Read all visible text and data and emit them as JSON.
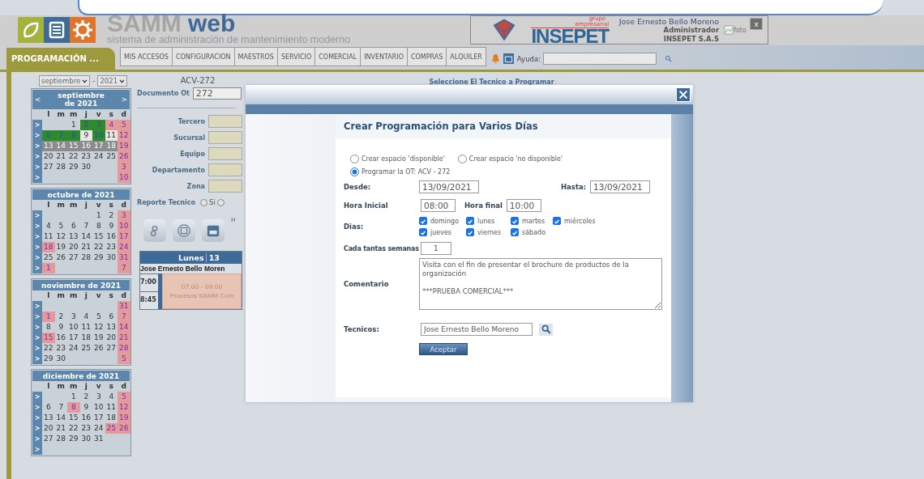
{
  "header": {
    "title_main": "SAMM",
    "title_accent": "web",
    "subtitle": "sistema de administración de mantenimiento moderno",
    "company": {
      "tagline_1": "grupo",
      "tagline_2": "empresarial",
      "name": "INSEPET"
    },
    "user": {
      "name": "Jose Ernesto Bello Moreno",
      "role": "Administrador",
      "company": "INSEPET S.A.S",
      "photo_alt": "foto",
      "close": "x"
    }
  },
  "nav": {
    "tabs": [
      {
        "label": "PROGRAMACIÓN ...",
        "selected": true
      }
    ],
    "menu": [
      "MIS ACCESOS",
      "CONFIGURACION",
      "MAESTROS",
      "SERVICIO",
      "COMERCIAL",
      "INVENTARIO",
      "COMPRAS",
      "ALQUILER"
    ],
    "help_label": "Ayuda:"
  },
  "calendar": {
    "month_select": "septiembre",
    "separator": "-",
    "year_select": "2021",
    "months": [
      {
        "title": "septiembre de 2021",
        "prev": "<",
        "next": ">",
        "weekdays": [
          "l",
          "m",
          "m",
          "j",
          "v",
          "s",
          "d"
        ],
        "weeks": [
          {
            "marker": ">",
            "days": [
              {
                "kind": "blank"
              },
              {
                "kind": "blank"
              },
              {
                "day": "1",
                "kind": "normal"
              },
              {
                "day": "2",
                "kind": "busy"
              },
              {
                "day": "3",
                "kind": "busy"
              },
              {
                "day": "4",
                "kind": "holiday"
              },
              {
                "day": "5",
                "kind": "holiday"
              }
            ]
          },
          {
            "marker": ">",
            "days": [
              {
                "day": "6",
                "kind": "busy"
              },
              {
                "day": "7",
                "kind": "busy"
              },
              {
                "day": "8",
                "kind": "busy"
              },
              {
                "day": "9",
                "kind": "light"
              },
              {
                "day": "10",
                "kind": "busy"
              },
              {
                "day": "11",
                "kind": "light"
              },
              {
                "day": "12",
                "kind": "holiday"
              }
            ]
          },
          {
            "marker": ">",
            "days": [
              {
                "day": "13",
                "kind": "shaded"
              },
              {
                "day": "14",
                "kind": "shaded"
              },
              {
                "day": "15",
                "kind": "shaded"
              },
              {
                "day": "16",
                "kind": "shaded"
              },
              {
                "day": "17",
                "kind": "shaded"
              },
              {
                "day": "18",
                "kind": "shaded"
              },
              {
                "day": "19",
                "kind": "holiday"
              }
            ]
          },
          {
            "marker": ">",
            "days": [
              {
                "day": "20",
                "kind": "normal"
              },
              {
                "day": "21",
                "kind": "normal"
              },
              {
                "day": "22",
                "kind": "normal"
              },
              {
                "day": "23",
                "kind": "normal"
              },
              {
                "day": "24",
                "kind": "normal"
              },
              {
                "day": "25",
                "kind": "normal"
              },
              {
                "day": "26",
                "kind": "holiday"
              }
            ]
          },
          {
            "marker": ">",
            "days": [
              {
                "day": "27",
                "kind": "normal"
              },
              {
                "day": "28",
                "kind": "normal"
              },
              {
                "day": "29",
                "kind": "normal"
              },
              {
                "day": "30",
                "kind": "normal"
              },
              {
                "kind": "blank"
              },
              {
                "kind": "blank"
              },
              {
                "day": "3",
                "kind": "holiday"
              }
            ]
          },
          {
            "marker": ">",
            "days": [
              {
                "kind": "blank"
              },
              {
                "kind": "blank"
              },
              {
                "kind": "blank"
              },
              {
                "kind": "blank"
              },
              {
                "kind": "blank"
              },
              {
                "kind": "blank"
              },
              {
                "day": "10",
                "kind": "holiday"
              }
            ]
          }
        ]
      },
      {
        "title": "octubre de 2021",
        "weekdays": [
          "l",
          "m",
          "m",
          "j",
          "v",
          "s",
          "d"
        ],
        "weeks": [
          {
            "marker": ">",
            "days": [
              {
                "kind": "blank"
              },
              {
                "kind": "blank"
              },
              {
                "kind": "blank"
              },
              {
                "kind": "blank"
              },
              {
                "day": "1",
                "kind": "normal"
              },
              {
                "day": "2",
                "kind": "normal"
              },
              {
                "day": "3",
                "kind": "holiday"
              }
            ]
          },
          {
            "marker": ">",
            "days": [
              {
                "day": "4",
                "kind": "normal"
              },
              {
                "day": "5",
                "kind": "normal"
              },
              {
                "day": "6",
                "kind": "normal"
              },
              {
                "day": "7",
                "kind": "normal"
              },
              {
                "day": "8",
                "kind": "normal"
              },
              {
                "day": "9",
                "kind": "normal"
              },
              {
                "day": "10",
                "kind": "holiday"
              }
            ]
          },
          {
            "marker": ">",
            "days": [
              {
                "day": "11",
                "kind": "normal"
              },
              {
                "day": "12",
                "kind": "normal"
              },
              {
                "day": "13",
                "kind": "normal"
              },
              {
                "day": "14",
                "kind": "normal"
              },
              {
                "day": "15",
                "kind": "normal"
              },
              {
                "day": "16",
                "kind": "normal"
              },
              {
                "day": "17",
                "kind": "holiday"
              }
            ]
          },
          {
            "marker": ">",
            "days": [
              {
                "day": "18",
                "kind": "holiday"
              },
              {
                "day": "19",
                "kind": "normal"
              },
              {
                "day": "20",
                "kind": "normal"
              },
              {
                "day": "21",
                "kind": "normal"
              },
              {
                "day": "22",
                "kind": "normal"
              },
              {
                "day": "23",
                "kind": "normal"
              },
              {
                "day": "24",
                "kind": "holiday"
              }
            ]
          },
          {
            "marker": ">",
            "days": [
              {
                "day": "25",
                "kind": "normal"
              },
              {
                "day": "26",
                "kind": "normal"
              },
              {
                "day": "27",
                "kind": "normal"
              },
              {
                "day": "28",
                "kind": "normal"
              },
              {
                "day": "29",
                "kind": "normal"
              },
              {
                "day": "30",
                "kind": "normal"
              },
              {
                "day": "31",
                "kind": "holiday"
              }
            ]
          },
          {
            "marker": ">",
            "days": [
              {
                "day": "1",
                "kind": "holiday"
              },
              {
                "kind": "blank"
              },
              {
                "kind": "blank"
              },
              {
                "kind": "blank"
              },
              {
                "kind": "blank"
              },
              {
                "kind": "blank"
              },
              {
                "day": "7",
                "kind": "holiday"
              }
            ]
          }
        ]
      },
      {
        "title": "noviembre de 2021",
        "weekdays": [
          "l",
          "m",
          "m",
          "j",
          "v",
          "s",
          "d"
        ],
        "weeks": [
          {
            "marker": ">",
            "days": [
              {
                "kind": "blank"
              },
              {
                "kind": "blank"
              },
              {
                "kind": "blank"
              },
              {
                "kind": "blank"
              },
              {
                "kind": "blank"
              },
              {
                "kind": "blank"
              },
              {
                "day": "31",
                "kind": "holiday"
              }
            ]
          },
          {
            "marker": ">",
            "days": [
              {
                "day": "1",
                "kind": "holiday"
              },
              {
                "day": "2",
                "kind": "normal"
              },
              {
                "day": "3",
                "kind": "normal"
              },
              {
                "day": "4",
                "kind": "normal"
              },
              {
                "day": "5",
                "kind": "normal"
              },
              {
                "day": "6",
                "kind": "normal"
              },
              {
                "day": "7",
                "kind": "holiday"
              }
            ]
          },
          {
            "marker": ">",
            "days": [
              {
                "day": "8",
                "kind": "normal"
              },
              {
                "day": "9",
                "kind": "normal"
              },
              {
                "day": "10",
                "kind": "normal"
              },
              {
                "day": "11",
                "kind": "normal"
              },
              {
                "day": "12",
                "kind": "normal"
              },
              {
                "day": "13",
                "kind": "normal"
              },
              {
                "day": "14",
                "kind": "holiday"
              }
            ]
          },
          {
            "marker": ">",
            "days": [
              {
                "day": "15",
                "kind": "holiday"
              },
              {
                "day": "16",
                "kind": "normal"
              },
              {
                "day": "17",
                "kind": "normal"
              },
              {
                "day": "18",
                "kind": "normal"
              },
              {
                "day": "19",
                "kind": "normal"
              },
              {
                "day": "20",
                "kind": "normal"
              },
              {
                "day": "21",
                "kind": "holiday"
              }
            ]
          },
          {
            "marker": ">",
            "days": [
              {
                "day": "22",
                "kind": "normal"
              },
              {
                "day": "23",
                "kind": "normal"
              },
              {
                "day": "24",
                "kind": "normal"
              },
              {
                "day": "25",
                "kind": "normal"
              },
              {
                "day": "26",
                "kind": "normal"
              },
              {
                "day": "27",
                "kind": "normal"
              },
              {
                "day": "28",
                "kind": "holiday"
              }
            ]
          },
          {
            "marker": ">",
            "days": [
              {
                "day": "29",
                "kind": "normal"
              },
              {
                "day": "30",
                "kind": "normal"
              },
              {
                "kind": "blank"
              },
              {
                "kind": "blank"
              },
              {
                "kind": "blank"
              },
              {
                "kind": "blank"
              },
              {
                "day": "5",
                "kind": "holiday"
              }
            ]
          }
        ]
      },
      {
        "title": "diciembre de 2021",
        "weekdays": [
          "l",
          "m",
          "m",
          "j",
          "v",
          "s",
          "d"
        ],
        "weeks": [
          {
            "marker": ">",
            "days": [
              {
                "kind": "blank"
              },
              {
                "kind": "blank"
              },
              {
                "day": "1",
                "kind": "normal"
              },
              {
                "day": "2",
                "kind": "normal"
              },
              {
                "day": "3",
                "kind": "normal"
              },
              {
                "day": "4",
                "kind": "normal"
              },
              {
                "day": "5",
                "kind": "holiday"
              }
            ]
          },
          {
            "marker": ">",
            "days": [
              {
                "day": "6",
                "kind": "normal"
              },
              {
                "day": "7",
                "kind": "normal"
              },
              {
                "day": "8",
                "kind": "holiday"
              },
              {
                "day": "9",
                "kind": "normal"
              },
              {
                "day": "10",
                "kind": "normal"
              },
              {
                "day": "11",
                "kind": "normal"
              },
              {
                "day": "12",
                "kind": "holiday"
              }
            ]
          },
          {
            "marker": ">",
            "days": [
              {
                "day": "13",
                "kind": "normal"
              },
              {
                "day": "14",
                "kind": "normal"
              },
              {
                "day": "15",
                "kind": "normal"
              },
              {
                "day": "16",
                "kind": "normal"
              },
              {
                "day": "17",
                "kind": "normal"
              },
              {
                "day": "18",
                "kind": "normal"
              },
              {
                "day": "19",
                "kind": "holiday"
              }
            ]
          },
          {
            "marker": ">",
            "days": [
              {
                "day": "20",
                "kind": "normal"
              },
              {
                "day": "21",
                "kind": "normal"
              },
              {
                "day": "22",
                "kind": "normal"
              },
              {
                "day": "23",
                "kind": "normal"
              },
              {
                "day": "24",
                "kind": "normal"
              },
              {
                "day": "25",
                "kind": "holiday"
              },
              {
                "day": "26",
                "kind": "holiday"
              }
            ]
          },
          {
            "marker": ">",
            "days": [
              {
                "day": "27",
                "kind": "normal"
              },
              {
                "day": "28",
                "kind": "normal"
              },
              {
                "day": "29",
                "kind": "normal"
              },
              {
                "day": "30",
                "kind": "normal"
              },
              {
                "day": "31",
                "kind": "normal"
              },
              {
                "kind": "blank"
              },
              {
                "kind": "blank"
              }
            ]
          },
          {
            "marker": ">",
            "days": [
              {
                "kind": "blank"
              },
              {
                "kind": "blank"
              },
              {
                "kind": "blank"
              },
              {
                "kind": "blank"
              },
              {
                "kind": "blank"
              },
              {
                "kind": "blank"
              },
              {
                "kind": "blank"
              }
            ]
          }
        ]
      }
    ]
  },
  "order": {
    "code": "ACV-272",
    "doc_label": "Documento Ot",
    "doc_value": "272",
    "fields": [
      {
        "label": "Tercero"
      },
      {
        "label": "Sucursal"
      },
      {
        "label": "Equipo"
      },
      {
        "label": "Departamento"
      },
      {
        "label": "Zona"
      }
    ],
    "report_label": "Reporte Tecnico",
    "report_options": [
      {
        "label": "Si",
        "selected": false
      },
      {
        "selected": false
      }
    ],
    "toolbar_text": "H",
    "schedule": {
      "day_label": "Lunes",
      "day_number": "13",
      "technician": "Jose Ernesto Bello Moren",
      "times": [
        "7:00",
        "8:45"
      ],
      "event": {
        "time": "07:00 - 09:00",
        "title": "Procesos SAMM Com"
      }
    }
  },
  "picker_title": "Seleccione El Tecnico a Programar",
  "dialog": {
    "heading": "Crear Programación para Varios Días",
    "modes": [
      {
        "label": "Crear espacio 'disponible'",
        "selected": false
      },
      {
        "label": "Crear espacio 'no disponible'",
        "selected": false
      },
      {
        "label": "Programar la OT: ACV - 272",
        "selected": true
      }
    ],
    "from_label": "Desde:",
    "from": "13/09/2021",
    "to_label": "Hasta:",
    "to": "13/09/2021",
    "start_label": "Hora Inicial",
    "start": "08:00",
    "end_label": "Hora final",
    "end": "10:00",
    "days_label": "Dias:",
    "days": [
      {
        "label": "domingo",
        "checked": true
      },
      {
        "label": "lunes",
        "checked": true
      },
      {
        "label": "martes",
        "checked": true
      },
      {
        "label": "miércoles",
        "checked": true
      },
      {
        "label": "jueves",
        "checked": true
      },
      {
        "label": "viernes",
        "checked": true
      },
      {
        "label": "sábado",
        "checked": true
      }
    ],
    "weeks_label": "Cada tantas semanas",
    "weeks": "1",
    "comment_label": "Comentario",
    "comment": "Visita con el fin de presentar el brochure de productos de la organización\n\n***PRUEBA COMERCIAL***",
    "tech_label": "Tecnicos:",
    "tech": "Jose Ernesto Bello Moreno",
    "submit": "Aceptar"
  }
}
